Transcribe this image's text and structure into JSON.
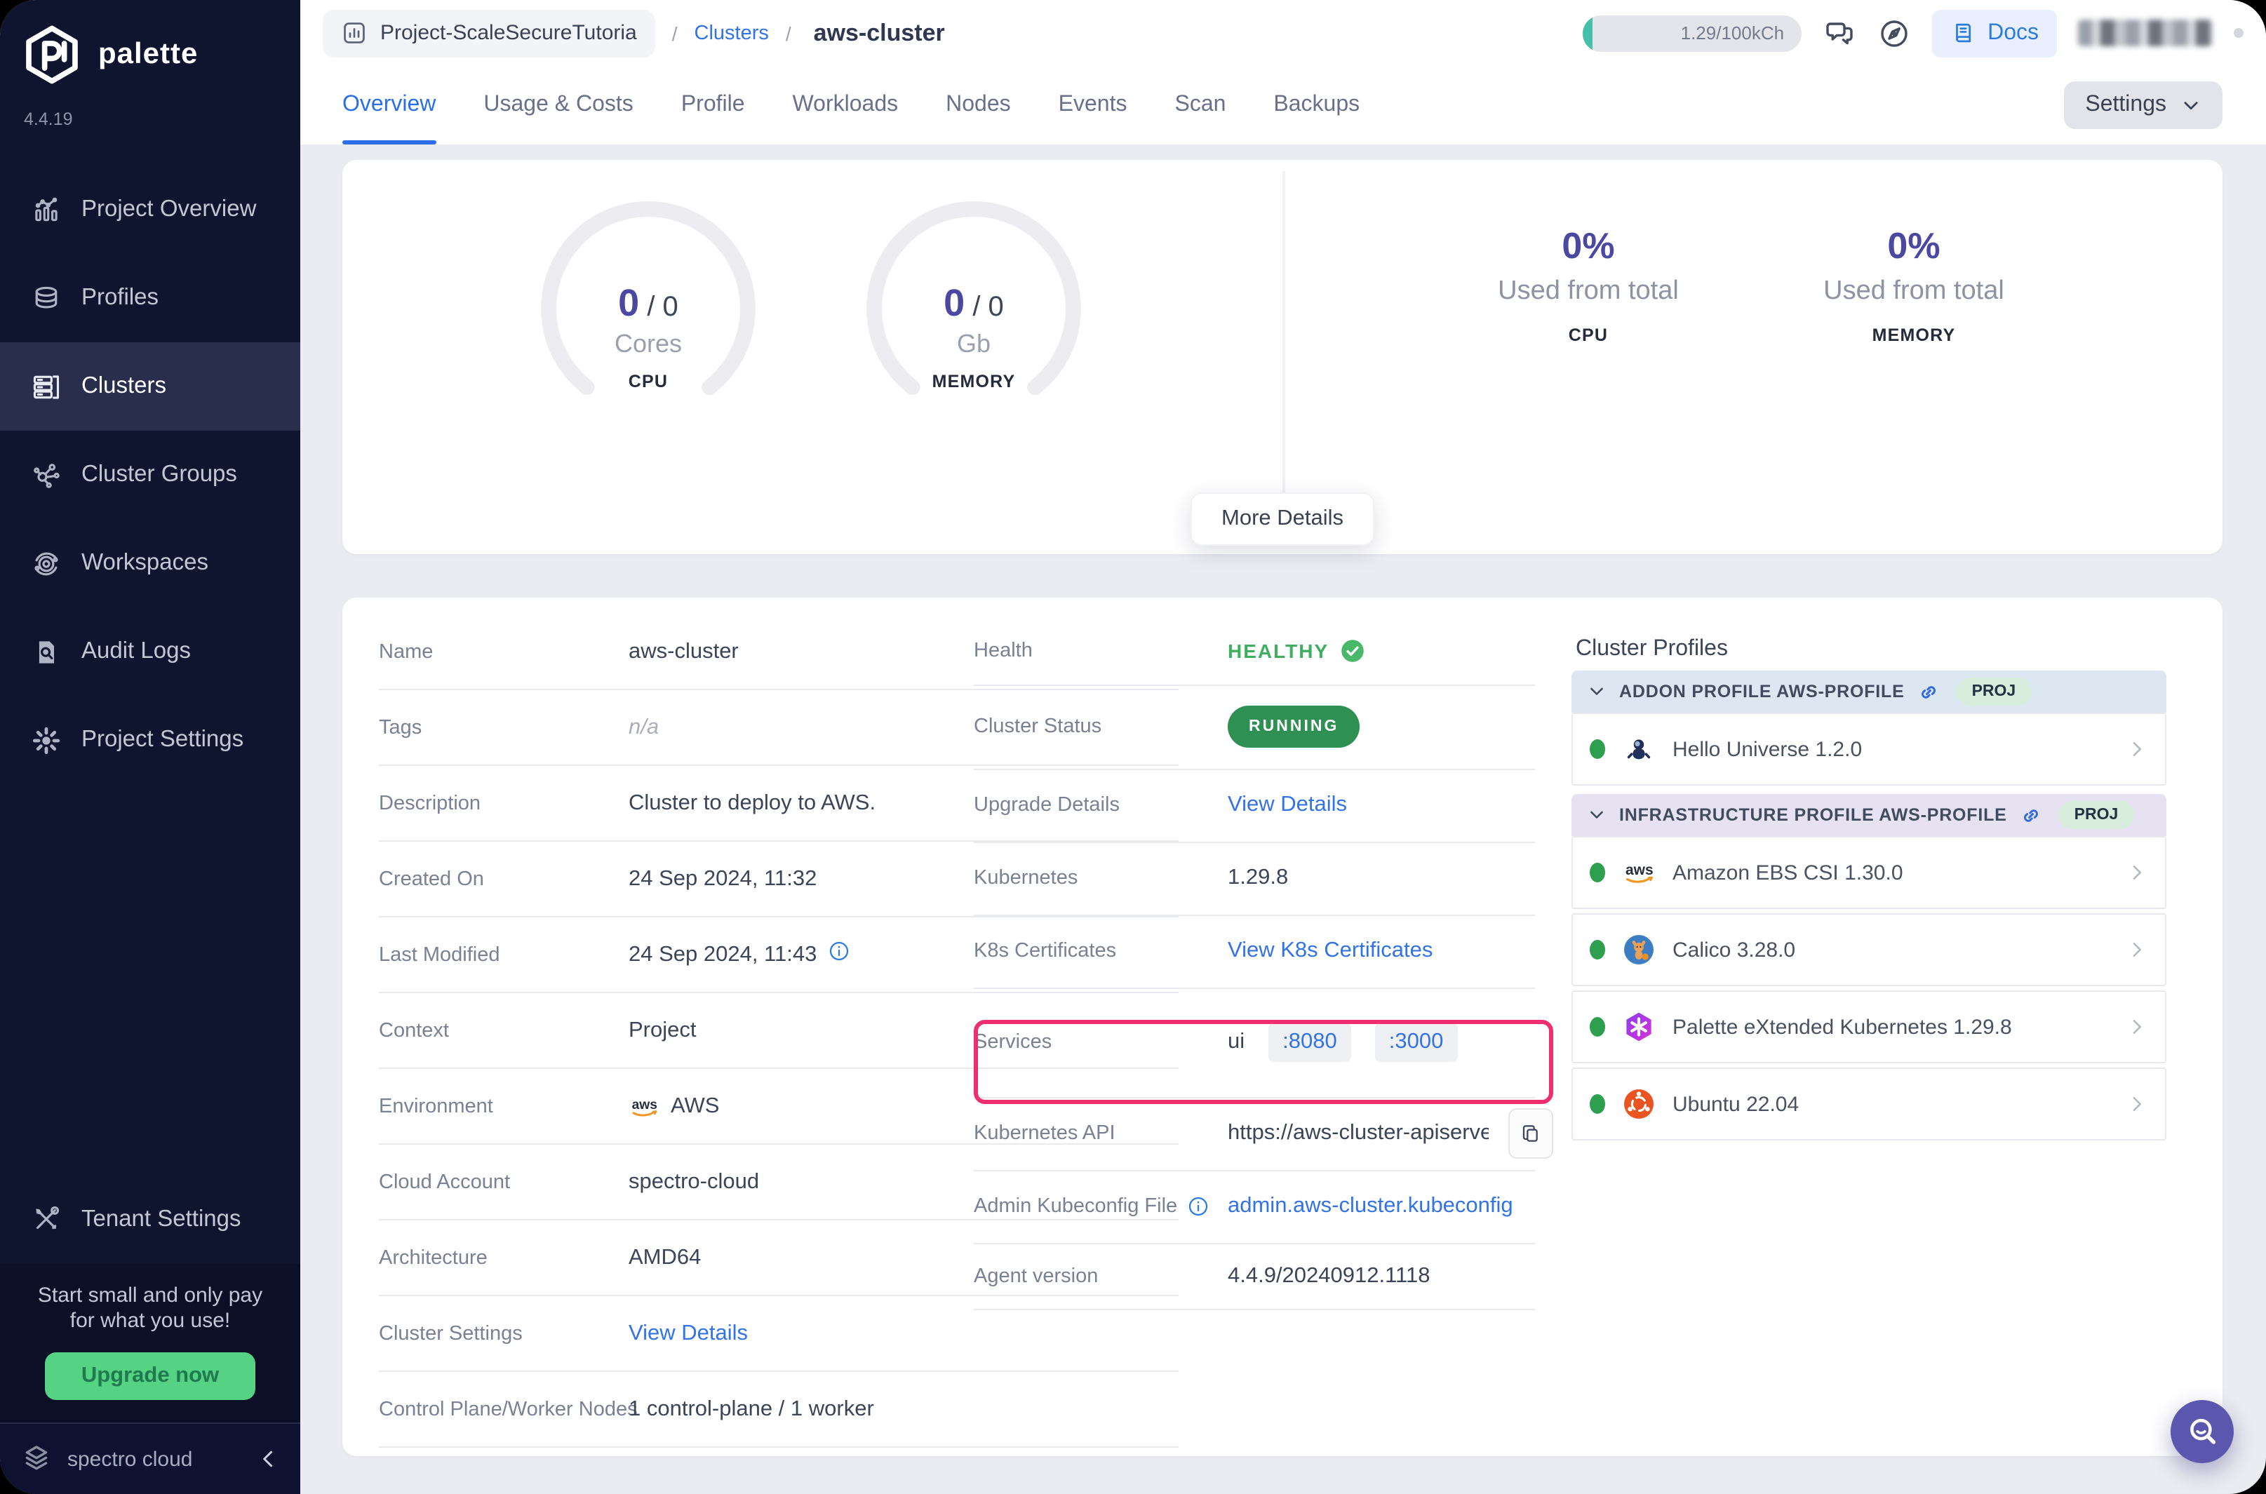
{
  "sidebar": {
    "logo": "palette",
    "version": "4.4.19",
    "items": [
      {
        "label": "Project Overview",
        "icon": "project-overview",
        "active": false
      },
      {
        "label": "Profiles",
        "icon": "profiles",
        "active": false
      },
      {
        "label": "Clusters",
        "icon": "clusters",
        "active": true
      },
      {
        "label": "Cluster Groups",
        "icon": "cluster-groups",
        "active": false
      },
      {
        "label": "Workspaces",
        "icon": "workspaces",
        "active": false
      },
      {
        "label": "Audit Logs",
        "icon": "audit-logs",
        "active": false
      },
      {
        "label": "Project Settings",
        "icon": "project-settings",
        "active": false
      }
    ],
    "tenant": {
      "label": "Tenant Settings",
      "icon": "tenant-settings"
    },
    "promo": {
      "line1": "Start small and only pay",
      "line2": "for what you use!",
      "button": "Upgrade now"
    },
    "footer": {
      "brand": "spectro cloud"
    }
  },
  "header": {
    "breadcrumb": {
      "project": "Project-ScaleSecureTutoria",
      "separator": "/",
      "section": "Clusters",
      "current": "aws-cluster"
    },
    "usage_pill": "1.29/100kCh",
    "docs_label": "Docs"
  },
  "tabs": {
    "items": [
      {
        "label": "Overview",
        "active": true
      },
      {
        "label": "Usage & Costs",
        "active": false
      },
      {
        "label": "Profile",
        "active": false
      },
      {
        "label": "Workloads",
        "active": false
      },
      {
        "label": "Nodes",
        "active": false
      },
      {
        "label": "Events",
        "active": false
      },
      {
        "label": "Scan",
        "active": false
      },
      {
        "label": "Backups",
        "active": false
      }
    ],
    "settings_label": "Settings"
  },
  "overview": {
    "gauges": [
      {
        "value": "0",
        "total": "0",
        "unit": "Cores",
        "label": "CPU"
      },
      {
        "value": "0",
        "total": "0",
        "unit": "Gb",
        "label": "MEMORY"
      }
    ],
    "usage": [
      {
        "percent": "0%",
        "caption": "Used from total",
        "label": "CPU"
      },
      {
        "percent": "0%",
        "caption": "Used from total",
        "label": "MEMORY"
      }
    ],
    "more_details": "More Details"
  },
  "details": {
    "left": [
      {
        "label": "Name",
        "value": "aws-cluster",
        "type": "text"
      },
      {
        "label": "Tags",
        "value": "n/a",
        "type": "muted"
      },
      {
        "label": "Description",
        "value": "Cluster to deploy to AWS.",
        "type": "text"
      },
      {
        "label": "Created On",
        "value": "24 Sep 2024, 11:32",
        "type": "text"
      },
      {
        "label": "Last Modified",
        "value": "24 Sep 2024, 11:43",
        "type": "date-info"
      },
      {
        "label": "Context",
        "value": "Project",
        "type": "text"
      },
      {
        "label": "Environment",
        "value": "AWS",
        "type": "env"
      },
      {
        "label": "Cloud Account",
        "value": "spectro-cloud",
        "type": "text"
      },
      {
        "label": "Architecture",
        "value": "AMD64",
        "type": "text"
      },
      {
        "label": "Cluster Settings",
        "value": "View Details",
        "type": "link"
      },
      {
        "label": "Control Plane/Worker Nodes",
        "value": "1 control-plane / 1 worker",
        "type": "text"
      }
    ],
    "middle": [
      {
        "label": "Health",
        "value": "HEALTHY",
        "type": "health"
      },
      {
        "label": "Cluster Status",
        "value": "RUNNING",
        "type": "badge"
      },
      {
        "label": "Upgrade Details",
        "value": "View Details",
        "type": "link"
      },
      {
        "label": "Kubernetes",
        "value": "1.29.8",
        "type": "text"
      },
      {
        "label": "K8s Certificates",
        "value": "View K8s Certificates",
        "type": "link"
      },
      {
        "label": "Services",
        "value": "ui",
        "ports": [
          ":8080",
          ":3000"
        ],
        "type": "services",
        "highlighted": true
      },
      {
        "label": "Kubernetes API",
        "value": "https://aws-cluster-apiserve...",
        "type": "api"
      },
      {
        "label": "Admin Kubeconfig File",
        "value": "admin.aws-cluster.kubeconfig",
        "type": "kubeconfig",
        "label_info": true
      },
      {
        "label": "Agent version",
        "value": "4.4.9/20240912.1118",
        "type": "text"
      }
    ]
  },
  "profiles": {
    "title": "Cluster Profiles",
    "sections": [
      {
        "label": "ADDON PROFILE AWS-PROFILE",
        "badge": "PROJ",
        "theme": "addon",
        "items": [
          {
            "name": "Hello Universe 1.2.0",
            "icon": "hello-universe"
          }
        ]
      },
      {
        "label": "INFRASTRUCTURE PROFILE AWS-PROFILE",
        "badge": "PROJ",
        "theme": "infra",
        "items": [
          {
            "name": "Amazon EBS CSI 1.30.0",
            "icon": "aws"
          },
          {
            "name": "Calico 3.28.0",
            "icon": "calico"
          },
          {
            "name": "Palette eXtended Kubernetes 1.29.8",
            "icon": "pxk"
          },
          {
            "name": "Ubuntu 22.04",
            "icon": "ubuntu"
          }
        ]
      }
    ]
  },
  "colors": {
    "accent_purple": "#4b48a1",
    "link_blue": "#3273e8",
    "healthy_green": "#3fae5f",
    "running_green": "#2f9054",
    "highlight_pink": "#ef2e6d",
    "sidebar_bg": "#10152f",
    "upgrade_green": "#55d284",
    "fab_purple": "#5b56ae"
  }
}
